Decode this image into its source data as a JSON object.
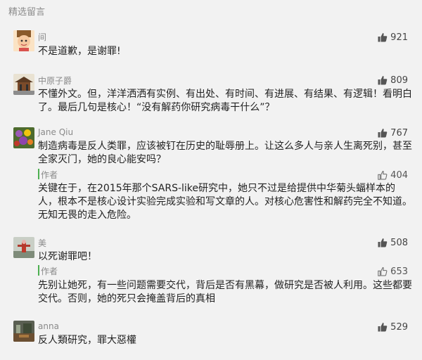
{
  "header": {
    "title": "精选留言"
  },
  "comments": [
    {
      "nickname": "间",
      "text": "不是道歉，是谢罪!",
      "likes": "921"
    },
    {
      "nickname": "中原子爵",
      "text": "不懂外文。但，洋洋洒洒有实例、有出处、有时间、有进展、有结果、有逻辑！看明白了。最后几句是核心！“没有解药你研究病毒干什么”？",
      "likes": "809"
    },
    {
      "nickname": "Jane Qiu",
      "text": "制造病毒是反人类罪，应该被钉在历史的耻辱册上。让这么多人与亲人生离死别，甚至全家灭门，她的良心能安吗？",
      "likes": "767",
      "reply": {
        "label": "作者",
        "text": "关键在于，在2015年那个SARS-like研究中，她只不过是给提供中华菊头蝠样本的人，根本不是核心设计实验完成实验和写文章的人。对核心危害性和解药完全不知道。无知无畏的走入危险。",
        "likes": "404"
      }
    },
    {
      "nickname": "美",
      "text": "以死谢罪吧！",
      "likes": "508",
      "reply": {
        "label": "作者",
        "text": "先别让她死，有一些问题需要交代，背后是否有黑幕，做研究是否被人利用。这些都要交代。否则，她的死只会掩盖背后的真相",
        "likes": "653"
      }
    },
    {
      "nickname": "anna",
      "text": "反人類研究，罪大惡權",
      "likes": "529"
    }
  ],
  "icons": {
    "like": "thumbs-up-icon"
  },
  "colors": {
    "background": "#f2f2f2",
    "reply_bar": "#4caf50",
    "like_filled": "#555555"
  }
}
